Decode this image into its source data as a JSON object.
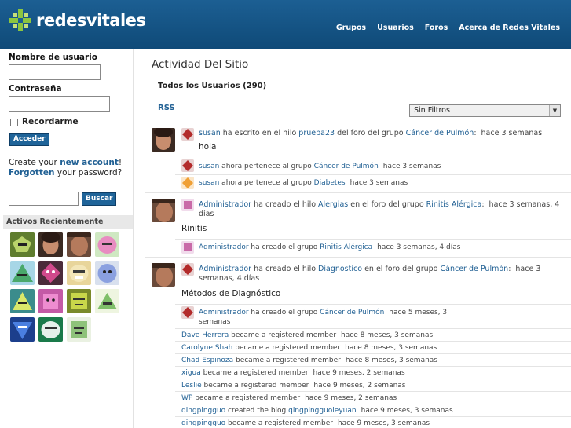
{
  "brand": {
    "name": "redesvitales"
  },
  "nav": [
    "Grupos",
    "Usuarios",
    "Foros",
    "Acerca de Redes Vitales"
  ],
  "login": {
    "username_label": "Nombre de usuario",
    "password_label": "Contraseña",
    "remember_label": "Recordarme",
    "submit_label": "Acceder",
    "create_prefix": "Create your ",
    "new_account_link": "new account",
    "create_suffix": "!",
    "forgotten_link": "Forgotten",
    "forgotten_suffix": " your password?"
  },
  "search": {
    "button_label": "Buscar"
  },
  "active": {
    "heading": "Activos Recientemente"
  },
  "main": {
    "title": "Actividad Del Sitio",
    "tab_label": "Todos los Usuarios (290)",
    "rss_label": "RSS",
    "filter_value": "Sin Filtros"
  },
  "feed": {
    "a1": {
      "user": "susan",
      "t1": " ha escrito en el hilo ",
      "thread": "prueba23",
      "t2": " del foro del grupo ",
      "group": "Cáncer de Pulmón",
      "t3": ":",
      "time": "hace 3 semanas",
      "msg": "hola"
    },
    "a2": {
      "user": "susan",
      "t1": " ahora pertenece al grupo ",
      "group": "Cáncer de Pulmón",
      "time": "hace 3 semanas"
    },
    "a3": {
      "user": "susan",
      "t1": " ahora pertenece al grupo ",
      "group": "Diabetes",
      "time": "hace 3 semanas"
    },
    "a4": {
      "user": "Administrador",
      "t1": " ha creado el hilo ",
      "thread": "Alergias",
      "t2": " en el foro del grupo ",
      "group": "Rinitis Alérgica",
      "t3": ":",
      "time": "hace 3 semanas, 4 días",
      "msg": "Rinitis"
    },
    "a5": {
      "user": "Administrador",
      "t1": " ha creado el grupo ",
      "group": "Rinitis Alérgica",
      "time": "hace 3 semanas, 4 días"
    },
    "a6": {
      "user": "Administrador",
      "t1": " ha creado el hilo ",
      "thread": "Diagnostico",
      "t2": " en el foro del grupo ",
      "group": "Cáncer de Pulmón",
      "t3": ":",
      "time": "hace 3 semanas, 4 días",
      "msg": "Métodos de Diagnóstico"
    },
    "a7": {
      "user": "Administrador",
      "t1": " ha creado el grupo ",
      "group": "Cáncer de Pulmón",
      "time": "hace 5 meses, 3 semanas"
    },
    "m1": {
      "user": "Dave Herrera",
      "t1": " became a registered member",
      "time": "hace 8 meses, 3 semanas"
    },
    "m2": {
      "user": "Carolyne Shah",
      "t1": " became a registered member",
      "time": "hace 8 meses, 3 semanas"
    },
    "m3": {
      "user": "Chad Espinoza",
      "t1": " became a registered member",
      "time": "hace 8 meses, 3 semanas"
    },
    "m4": {
      "user": "xigua",
      "t1": " became a registered member",
      "time": "hace 9 meses, 2 semanas"
    },
    "m5": {
      "user": "Leslie",
      "t1": " became a registered member",
      "time": "hace 9 meses, 2 semanas"
    },
    "m6": {
      "user": "WP",
      "t1": " became a registered member",
      "time": "hace 9 meses, 2 semanas"
    },
    "m7": {
      "user": "qingpingguo",
      "t1": " created the blog ",
      "blog": "qingpingguoleyuan",
      "time": "hace 9 meses, 3 semanas"
    },
    "m8": {
      "user": "qingpingguo",
      "t1": " became a registered member",
      "time": "hace 9 meses, 3 semanas"
    }
  }
}
